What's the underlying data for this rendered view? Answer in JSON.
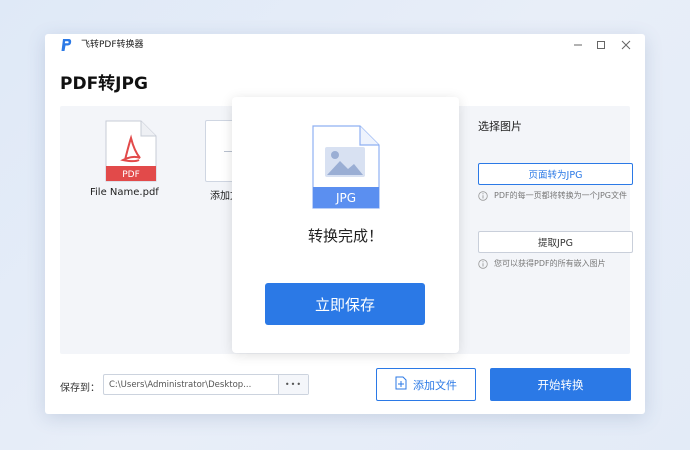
{
  "window": {
    "app_name": "飞转PDF转换器",
    "minimize_icon": "minimize-icon",
    "maximize_icon": "maximize-icon",
    "close_icon": "close-icon"
  },
  "page_title": "PDF转JPG",
  "files": [
    {
      "name": "File Name.pdf",
      "icon": "pdf-file-icon",
      "badge": "PDF"
    }
  ],
  "add_card": {
    "label": "添加文",
    "icon": "plus-icon"
  },
  "options": {
    "title": "选择图片",
    "items": [
      {
        "label": "页面转为JPG",
        "note": "PDF的每一页都将转换为一个JPG文件",
        "selected": true
      },
      {
        "label": "提取JPG",
        "note": "您可以获得PDF的所有嵌入图片",
        "selected": false
      }
    ]
  },
  "footer": {
    "save_label": "保存到：",
    "path": "C:\\Users\\Administrator\\Desktop...",
    "more": "•••",
    "add_file_label": "添加文件",
    "start_label": "开始转换"
  },
  "modal": {
    "file_badge": "JPG",
    "message": "转换完成！",
    "save_button": "立即保存"
  },
  "colors": {
    "accent": "#2b79e6",
    "pdf_red": "#e24a4a",
    "jpg_blue": "#5b8ff0"
  }
}
